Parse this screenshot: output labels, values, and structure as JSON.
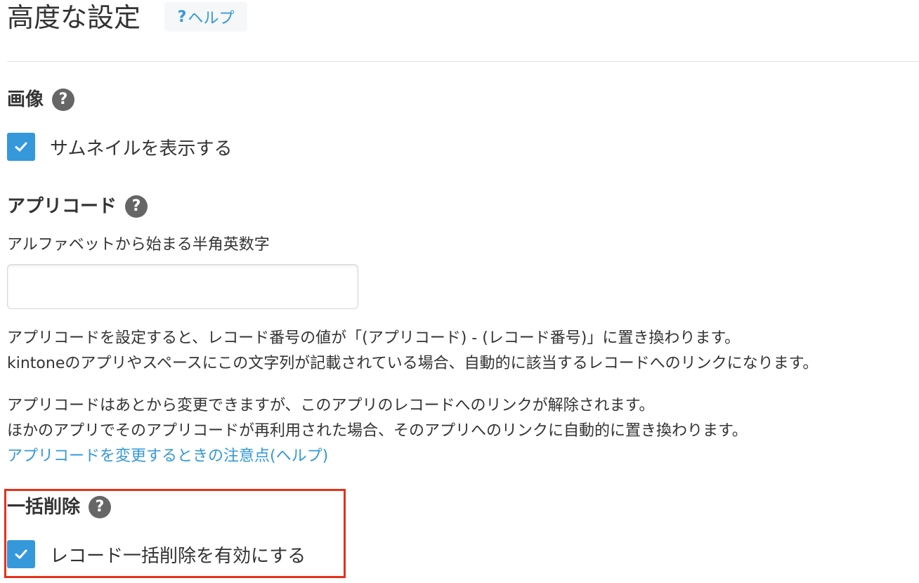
{
  "header": {
    "title": "高度な設定",
    "help_q": "?",
    "help_label": "ヘルプ"
  },
  "image_section": {
    "title": "画像",
    "help_icon": "question-circle-icon",
    "thumbnail_checkbox": {
      "label": "サムネイルを表示する",
      "checked": true
    }
  },
  "app_code_section": {
    "title": "アプリコード",
    "help_icon": "question-circle-icon",
    "caption": "アルファベットから始まる半角英数字",
    "input_value": "",
    "description_1": [
      "アプリコードを設定すると、レコード番号の値が「(アプリコード) - (レコード番号)」に置き換わります。",
      "kintoneのアプリやスペースにこの文字列が記載されている場合、自動的に該当するレコードへのリンクになります。"
    ],
    "description_2": [
      "アプリコードはあとから変更できますが、このアプリのレコードへのリンクが解除されます。",
      "ほかのアプリでそのアプリコードが再利用された場合、そのアプリへのリンクに自動的に置き換わります。"
    ],
    "help_link": "アプリコードを変更するときの注意点(ヘルプ)"
  },
  "bulk_delete_section": {
    "title": "一括削除",
    "help_icon": "question-circle-icon",
    "bulk_delete_checkbox": {
      "label": "レコード一括削除を有効にする",
      "checked": true
    }
  },
  "colors": {
    "accent": "#3498db",
    "highlight": "#e4321b",
    "text": "#333333",
    "icon_gray": "#666666"
  }
}
